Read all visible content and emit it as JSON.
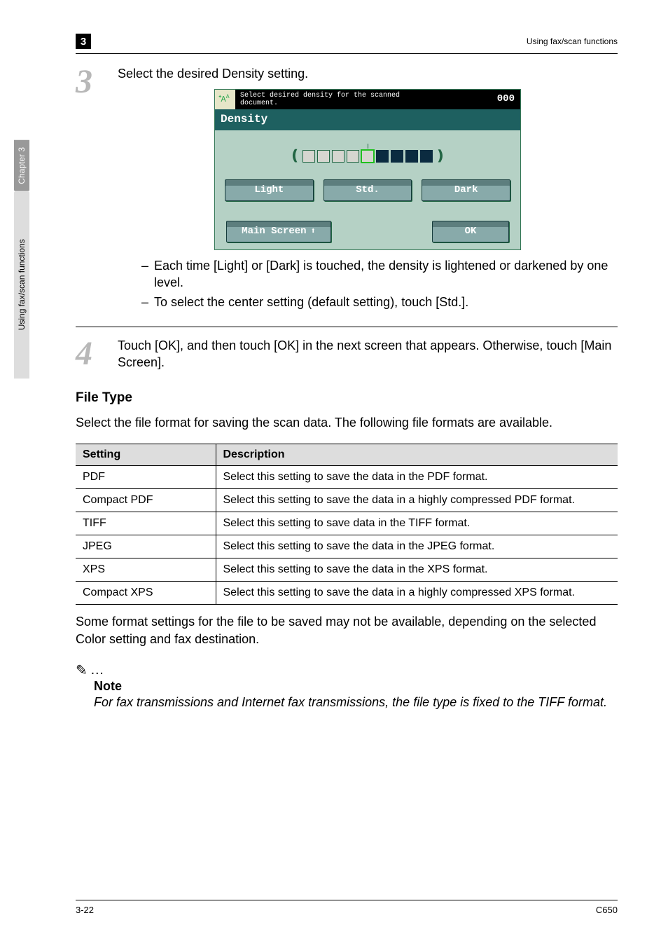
{
  "header": {
    "chapter_num": "3",
    "right_text": "Using fax/scan functions"
  },
  "sidetab": {
    "dark": "Chapter 3",
    "light": "Using fax/scan functions"
  },
  "step3": {
    "num": "3",
    "instruction": "Select the desired Density setting.",
    "panel": {
      "hint_line1": "Select desired density for the scanned",
      "hint_line2": "document.",
      "counter": "000",
      "title": "Density",
      "btn_light": "Light",
      "btn_std": "Std.",
      "btn_dark": "Dark",
      "btn_main": "Main Screen",
      "btn_ok": "OK",
      "icon_glyph": "A"
    },
    "bullets": [
      "Each time [Light] or [Dark] is touched, the density is lightened or darkened by one level.",
      "To select the center setting (default setting), touch [Std.]."
    ]
  },
  "step4": {
    "num": "4",
    "text": "Touch [OK], and then touch [OK] in the next screen that appears. Otherwise, touch [Main Screen]."
  },
  "file_type": {
    "heading": "File Type",
    "intro": "Select the file format for saving the scan data. The following file formats are available.",
    "th_setting": "Setting",
    "th_desc": "Description",
    "rows": [
      {
        "s": "PDF",
        "d": "Select this setting to save the data in the PDF format."
      },
      {
        "s": "Compact PDF",
        "d": "Select this setting to save the data in a highly compressed PDF format."
      },
      {
        "s": "TIFF",
        "d": "Select this setting to save data in the TIFF format."
      },
      {
        "s": "JPEG",
        "d": "Select this setting to save the data in the JPEG format."
      },
      {
        "s": "XPS",
        "d": "Select this setting to save the data in the XPS format."
      },
      {
        "s": "Compact XPS",
        "d": "Select this setting to save the data in a highly compressed XPS format."
      }
    ],
    "after": "Some format settings for the file to be saved may not be available, depending on the selected Color setting and fax destination."
  },
  "note": {
    "mark": "✎",
    "dots": "…",
    "head": "Note",
    "body": "For fax transmissions and Internet fax transmissions, the file type is fixed to the TIFF format."
  },
  "footer": {
    "left": "3-22",
    "right": "C650"
  }
}
